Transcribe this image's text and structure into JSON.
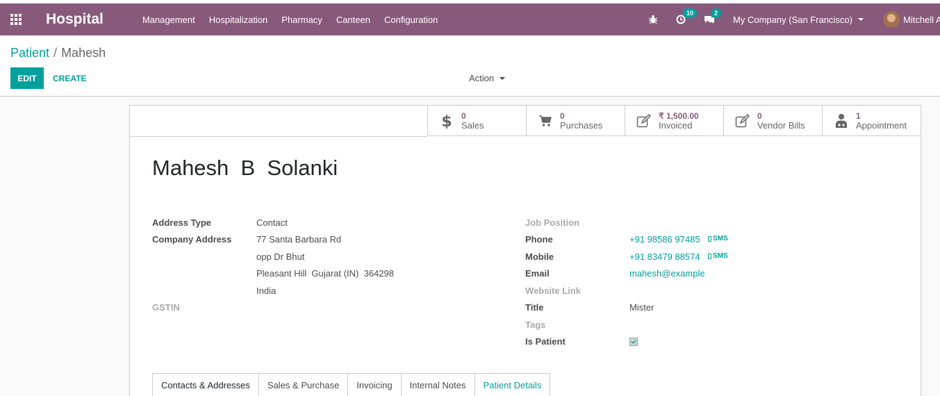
{
  "navbar": {
    "brand": "Hospital",
    "menu": [
      "Management",
      "Hospitalization",
      "Pharmacy",
      "Canteen",
      "Configuration"
    ],
    "activity_count": "10",
    "messages_count": "2",
    "company": "My Company (San Francisco)",
    "user": "Mitchell Admin"
  },
  "breadcrumb": {
    "parent": "Patient",
    "separator": "/",
    "current": "Mahesh"
  },
  "buttons": {
    "edit": "EDIT",
    "create": "CREATE",
    "action": "Action"
  },
  "stats": [
    {
      "value": "0",
      "label": "Sales",
      "icon": "dollar-icon"
    },
    {
      "value": "0",
      "label": "Purchases",
      "icon": "cart-icon"
    },
    {
      "value": "₹ 1,500.00",
      "label": "Invoiced",
      "icon": "edit-icon"
    },
    {
      "value": "0",
      "label": "Vendor Bills",
      "icon": "edit-icon"
    },
    {
      "value": "1",
      "label": "Appointment",
      "icon": "doctor-icon"
    }
  ],
  "partner": {
    "name": "Mahesh  B  Solanki",
    "address_type_label": "Address Type",
    "address_type": "Contact",
    "company_address_label": "Company Address",
    "street": "77 Santa Barbara Rd",
    "street2": "opp Dr Bhut",
    "city_line": "Pleasant Hill  Gujarat (IN)  364298",
    "country": "India",
    "gstin_label": "GSTIN",
    "job_position_label": "Job Position",
    "phone_label": "Phone",
    "phone": "+91 98586 97485",
    "mobile_label": "Mobile",
    "mobile": "+91 83479 88574",
    "sms_label": "SMS",
    "email_label": "Email",
    "email": "mahesh@example",
    "website_label": "Website Link",
    "title_label": "Title",
    "title": "Mister",
    "tags_label": "Tags",
    "is_patient_label": "Is Patient",
    "is_patient": true
  },
  "tabs": [
    "Contacts & Addresses",
    "Sales & Purchase",
    "Invoicing",
    "Internal Notes",
    "Patient Details"
  ],
  "colors": {
    "navbar": "#875a7b",
    "accent": "#00a09d"
  }
}
